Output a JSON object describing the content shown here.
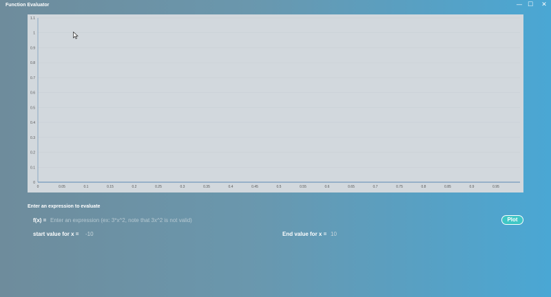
{
  "window": {
    "title": "Function Evaluator",
    "controls": {
      "minimize": "—",
      "maximize": "☐",
      "close": "✕"
    }
  },
  "chart_data": {
    "type": "line",
    "title": "",
    "xlabel": "",
    "ylabel": "",
    "x_ticks": [
      "0",
      "0.05",
      "0.1",
      "0.15",
      "0.2",
      "0.25",
      "0.3",
      "0.35",
      "0.4",
      "0.45",
      "0.5",
      "0.55",
      "0.6",
      "0.65",
      "0.7",
      "0.75",
      "0.8",
      "0.85",
      "0.9",
      "0.95"
    ],
    "y_ticks": [
      "0",
      "0.1",
      "0.2",
      "0.3",
      "0.4",
      "0.5",
      "0.6",
      "0.7",
      "0.8",
      "0.9",
      "1",
      "1.1"
    ],
    "xlim": [
      0,
      1
    ],
    "ylim": [
      0,
      1.1
    ],
    "grid": true,
    "series": [],
    "colors": {
      "axis": "#5b87b3",
      "grid": "#c5ccd2",
      "background": "#d2d8dd"
    }
  },
  "form": {
    "section_label": "Enter an expression to evaluate",
    "fx_label": "f(x) =",
    "expression_value": "",
    "expression_placeholder": "Enter an expression (ex: 3*x^2, note that 3x^2 is not valid)",
    "plot_label": "Plot",
    "start_label": "start value for x =",
    "start_value": "-10",
    "end_label": "End value for x =",
    "end_value": "10"
  },
  "colors": {
    "accent": "#3fc6c6"
  }
}
